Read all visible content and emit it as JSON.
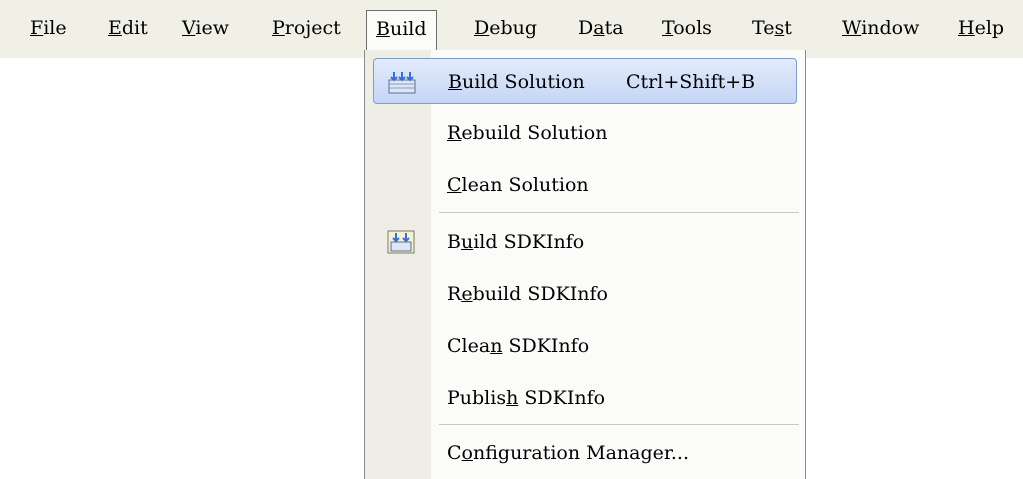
{
  "menubar": {
    "items": [
      {
        "label": "File",
        "mn": "F",
        "rest": "ile"
      },
      {
        "label": "Edit",
        "mn": "E",
        "rest": "dit"
      },
      {
        "label": "View",
        "mn": "V",
        "rest": "iew"
      },
      {
        "label": "Project",
        "mn": "P",
        "rest": "roject"
      },
      {
        "label": "Build",
        "mn": "B",
        "rest": "uild"
      },
      {
        "label": "Debug",
        "mn": "D",
        "rest": "ebug"
      },
      {
        "label": "Data",
        "pre": "D",
        "mn": "a",
        "rest": "ta"
      },
      {
        "label": "Tools",
        "mn": "T",
        "rest": "ools"
      },
      {
        "label": "Test",
        "pre": "Te",
        "mn": "s",
        "rest": "t"
      },
      {
        "label": "Window",
        "mn": "W",
        "rest": "indow"
      },
      {
        "label": "Help",
        "mn": "H",
        "rest": "elp"
      }
    ]
  },
  "build_menu": {
    "build_solution": {
      "pre": "",
      "mn": "B",
      "rest": "uild Solution",
      "shortcut": "Ctrl+Shift+B"
    },
    "rebuild_solution": {
      "pre": "",
      "mn": "R",
      "rest": "ebuild Solution"
    },
    "clean_solution": {
      "pre": "",
      "mn": "C",
      "rest": "lean Solution"
    },
    "build_sdkinfo": {
      "pre": "B",
      "mn": "u",
      "rest": "ild SDKInfo"
    },
    "rebuild_sdkinfo": {
      "pre": "R",
      "mn": "e",
      "rest": "build SDKInfo"
    },
    "clean_sdkinfo": {
      "pre": "Clea",
      "mn": "n",
      "rest": " SDKInfo"
    },
    "publish_sdkinfo": {
      "pre": "Publis",
      "mn": "h",
      "rest": " SDKInfo"
    },
    "configuration_manager": {
      "pre": "C",
      "mn": "o",
      "rest": "nfiguration Manager..."
    }
  },
  "colors": {
    "menubar_bg": "#f1f0e6",
    "highlight": "#c5d6f5",
    "icon_blue": "#3a6fd0"
  }
}
